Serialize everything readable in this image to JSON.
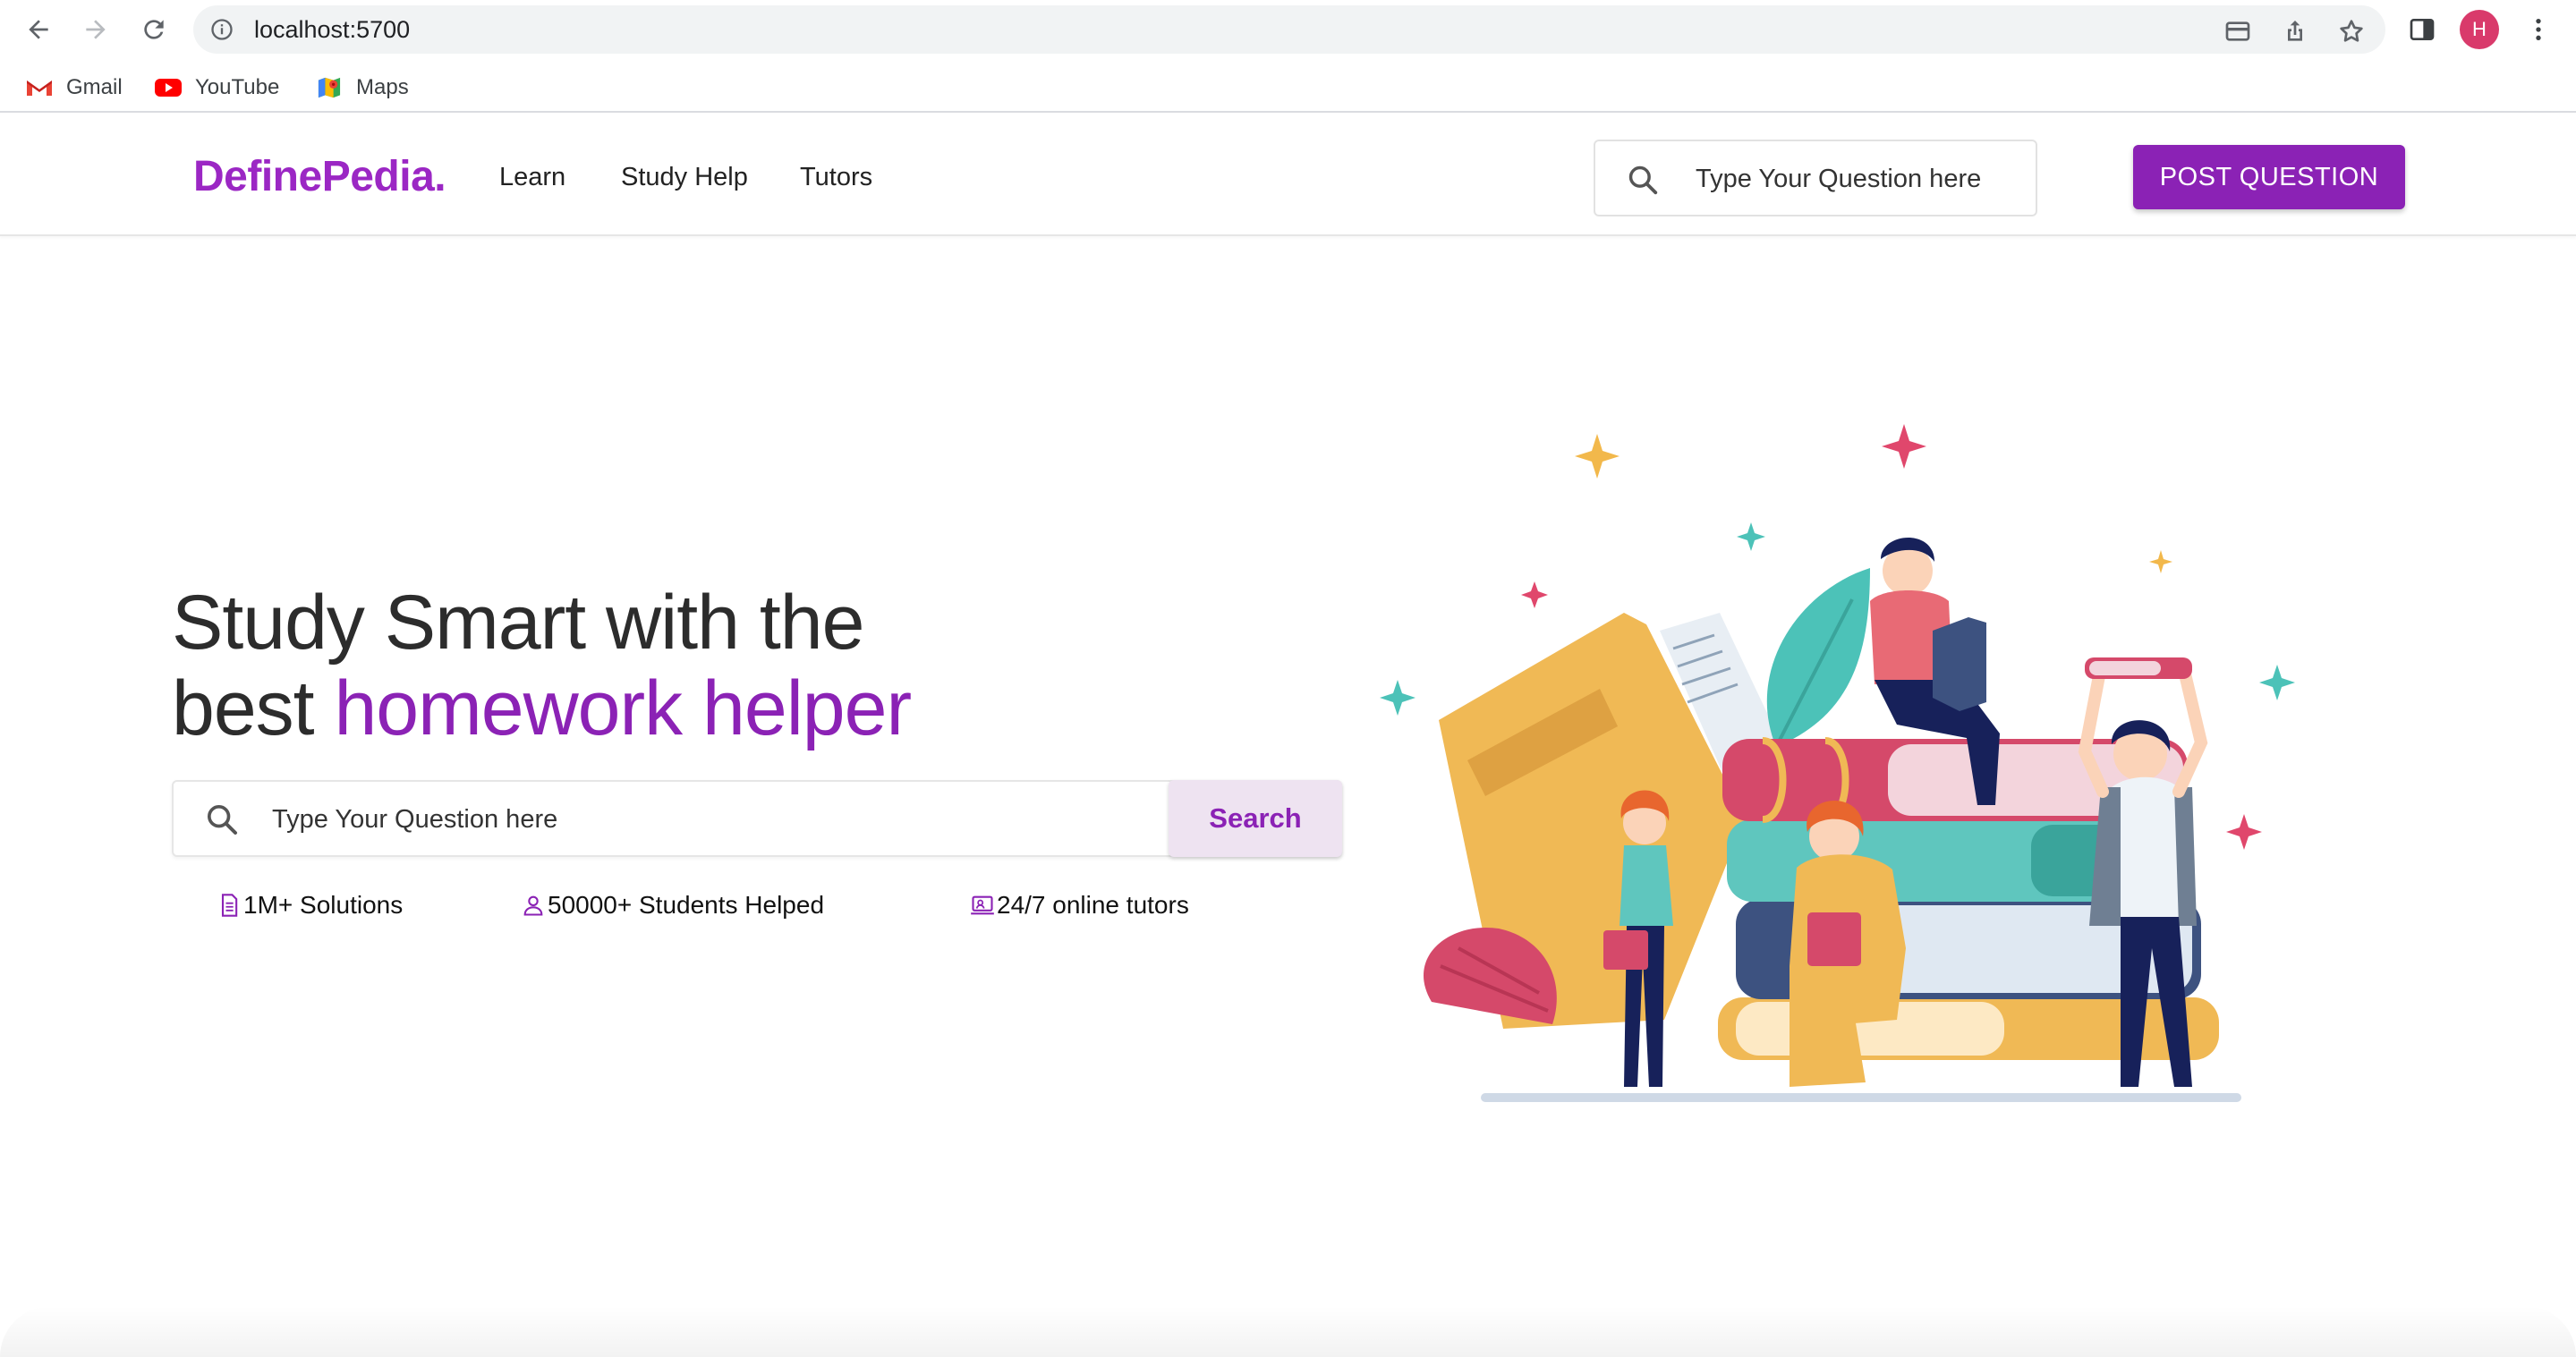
{
  "browser": {
    "url": "localhost:5700",
    "profile_initial": "H",
    "bookmarks": [
      {
        "label": "Gmail",
        "icon": "gmail-icon"
      },
      {
        "label": "YouTube",
        "icon": "youtube-icon"
      },
      {
        "label": "Maps",
        "icon": "maps-icon"
      }
    ]
  },
  "site": {
    "logo": "DefinePedia.",
    "nav": [
      "Learn",
      "Study Help",
      "Tutors"
    ],
    "header_search_placeholder": "Type Your Question here",
    "post_button": "POST QUESTION"
  },
  "hero": {
    "title_line1": "Study Smart with the",
    "title_line2_plain": "best ",
    "title_line2_accent": "homework helper",
    "search_placeholder": "Type Your Question here",
    "search_button": "Search",
    "stats": [
      {
        "icon": "document-icon",
        "label": "1M+ Solutions"
      },
      {
        "icon": "person-icon",
        "label": "50000+ Students Helped"
      },
      {
        "icon": "laptop-tutor-icon",
        "label": "24/7 online tutors"
      }
    ]
  },
  "colors": {
    "brand": "#8b22b5",
    "logo": "#9b27c4",
    "search_button_bg": "#eee3f1",
    "profile_avatar": "#d93a6b"
  }
}
